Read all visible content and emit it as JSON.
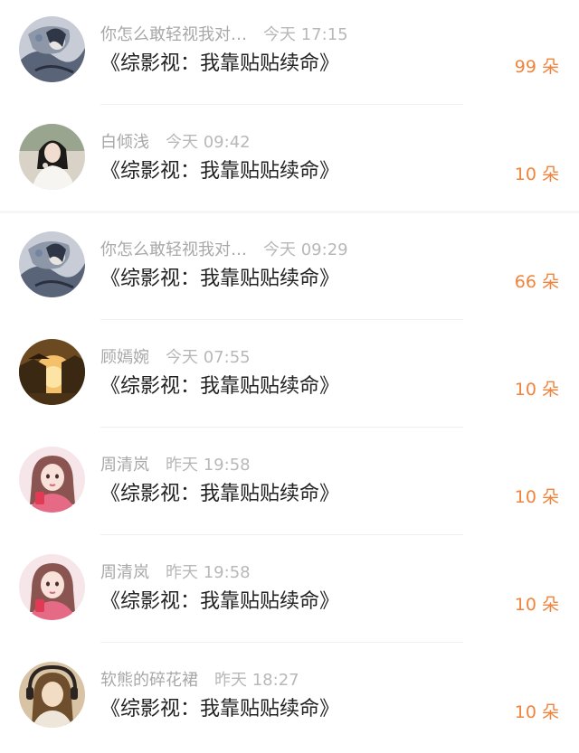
{
  "rows": [
    {
      "name": "你怎么敢轻视我对…",
      "time": "今天 17:15",
      "book": "《综影视：我靠贴贴续命》",
      "count": "99 朵",
      "avatar": "ink-painting-avatar"
    },
    {
      "name": "白倾浅",
      "time": "今天 09:42",
      "book": "《综影视：我靠贴贴续命》",
      "count": "10 朵",
      "avatar": "woman-white-dress-avatar"
    },
    {
      "name": "你怎么敢轻视我对…",
      "time": "今天 09:29",
      "book": "《综影视：我靠贴贴续命》",
      "count": "66 朵",
      "avatar": "ink-painting-avatar"
    },
    {
      "name": "顾嫣婉",
      "time": "今天 07:55",
      "book": "《综影视：我靠贴贴续命》",
      "count": "10 朵",
      "avatar": "sunset-palace-avatar"
    },
    {
      "name": "周清岚",
      "time": "昨天 19:58",
      "book": "《综影视：我靠贴贴续命》",
      "count": "10 朵",
      "avatar": "illustrated-girl-avatar"
    },
    {
      "name": "周清岚",
      "time": "昨天 19:58",
      "book": "《综影视：我靠贴贴续命》",
      "count": "10 朵",
      "avatar": "illustrated-girl-avatar"
    },
    {
      "name": "软熊的碎花裙",
      "time": "昨天 18:27",
      "book": "《综影视：我靠贴贴续命》",
      "count": "10 朵",
      "avatar": "girl-headphones-avatar"
    }
  ],
  "colors": {
    "count": "#f0843c",
    "title": "#222222",
    "meta": "#a8a8a8"
  }
}
